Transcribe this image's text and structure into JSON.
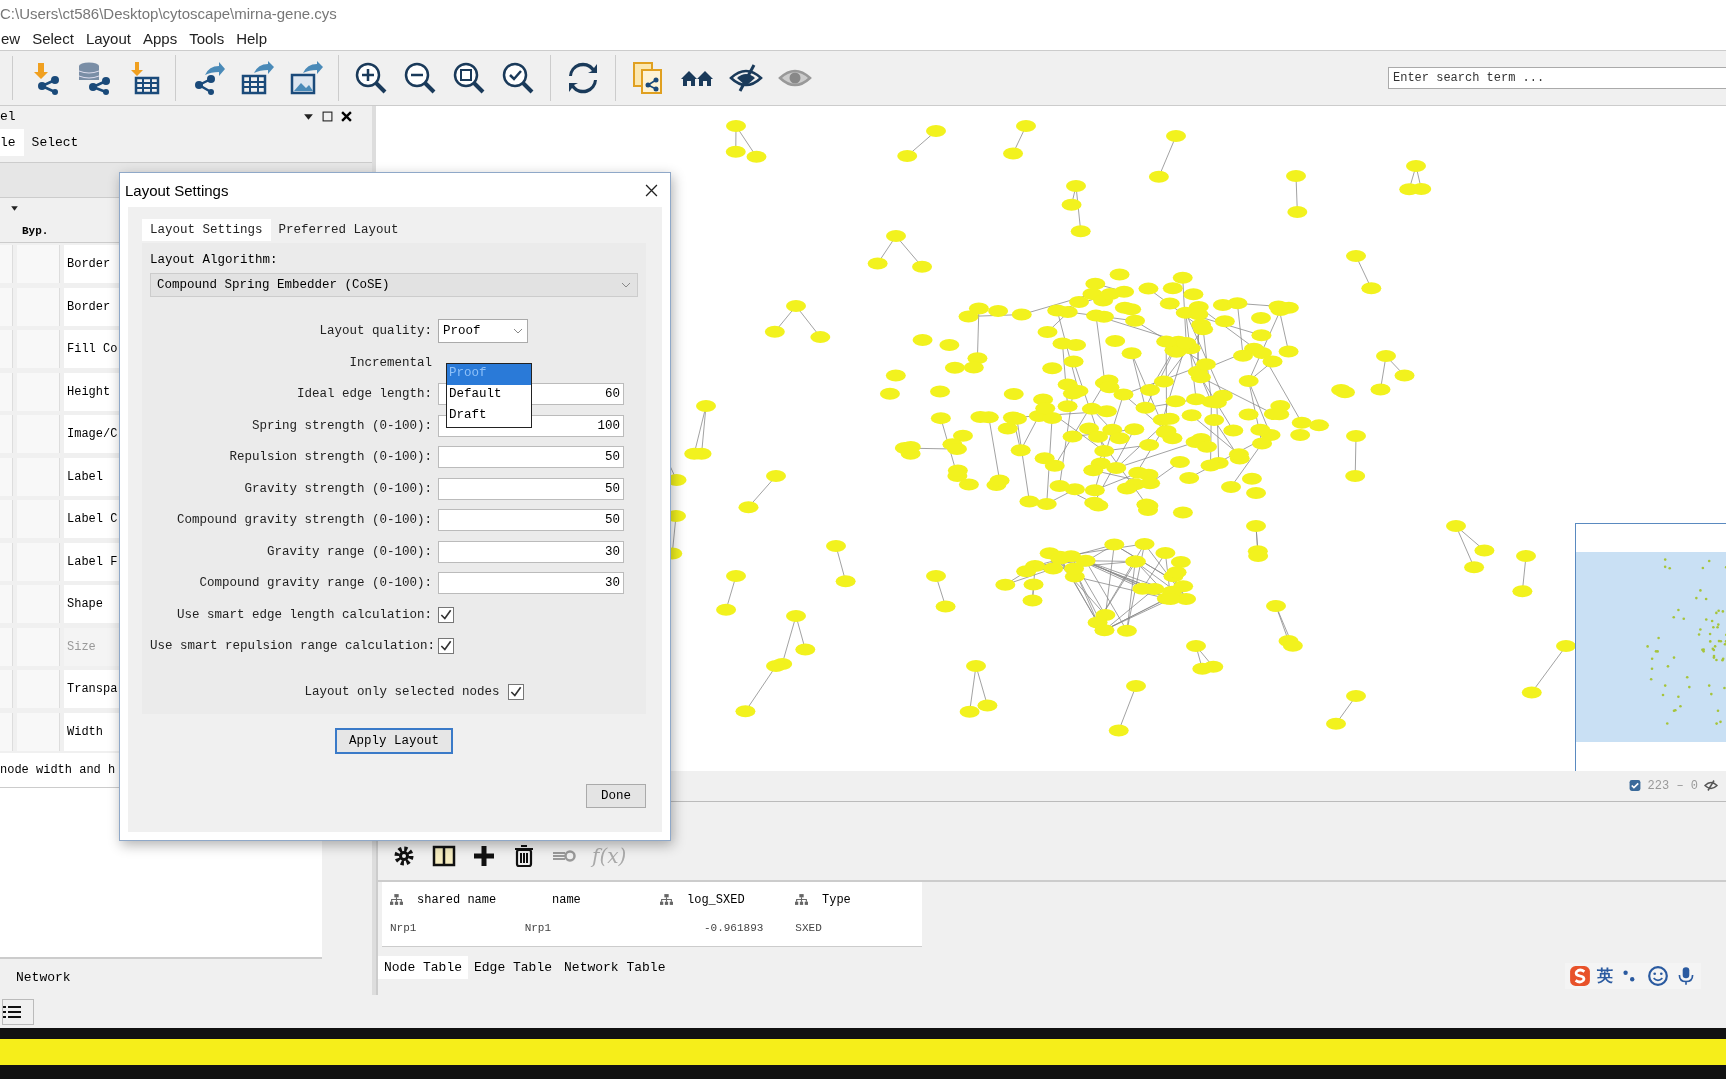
{
  "window": {
    "title": "C:\\Users\\ct586\\Desktop\\cytoscape\\mirna-gene.cys"
  },
  "menu": [
    {
      "label": "ew"
    },
    {
      "label": "Select"
    },
    {
      "label": "Layout"
    },
    {
      "label": "Apps"
    },
    {
      "label": "Tools"
    },
    {
      "label": "Help"
    }
  ],
  "search": {
    "placeholder": "Enter search term ..."
  },
  "control_panel": {
    "title": "el",
    "tabs": [
      {
        "label": "le",
        "selected": true
      },
      {
        "label": "Select",
        "selected": false
      }
    ],
    "column_header": "Byp.",
    "properties": [
      {
        "label": "Border",
        "disabled": false
      },
      {
        "label": "Border",
        "disabled": false
      },
      {
        "label": "Fill Co",
        "disabled": false
      },
      {
        "label": "Height",
        "disabled": false
      },
      {
        "label": "Image/C",
        "disabled": false
      },
      {
        "label": "Label",
        "disabled": false
      },
      {
        "label": "Label C",
        "disabled": false
      },
      {
        "label": "Label F",
        "disabled": false
      },
      {
        "label": "Shape",
        "disabled": false
      },
      {
        "label": "Size",
        "disabled": true
      },
      {
        "label": "Transpa",
        "disabled": false
      },
      {
        "label": "Width",
        "disabled": false
      }
    ],
    "note": "node width and h",
    "bottom_tab": "Network"
  },
  "network_view": {
    "status": "223 – 0"
  },
  "table_panel": {
    "formula_button": "f(x)",
    "columns": [
      {
        "label": "shared name",
        "shared": true
      },
      {
        "label": "name",
        "shared": false
      },
      {
        "label": "log_SXED",
        "shared": true
      },
      {
        "label": "Type",
        "shared": true
      }
    ],
    "rows": [
      [
        "Nrp1",
        "Nrp1",
        "-0.961893",
        "SXED"
      ]
    ],
    "tabs": [
      {
        "label": "Node Table",
        "selected": true
      },
      {
        "label": "Edge Table",
        "selected": false
      },
      {
        "label": "Network Table",
        "selected": false
      }
    ]
  },
  "dialog": {
    "title": "Layout Settings",
    "tabs": [
      {
        "label": "Layout Settings",
        "selected": true
      },
      {
        "label": "Preferred Layout",
        "selected": false
      }
    ],
    "algorithm_label": "Layout Algorithm:",
    "algorithm": "Compound Spring Embedder (CoSE)",
    "quality_label": "Layout quality:",
    "quality": "Proof",
    "quality_options": [
      {
        "label": "Proof",
        "selected": true
      },
      {
        "label": "Default",
        "selected": false
      },
      {
        "label": "Draft",
        "selected": false
      }
    ],
    "settings": [
      {
        "kind": "checkbox",
        "label": "Incremental"
      },
      {
        "kind": "number",
        "label": "Ideal edge length:",
        "value": "60"
      },
      {
        "kind": "number",
        "label": "Spring strength (0-100):",
        "value": "100"
      },
      {
        "kind": "number",
        "label": "Repulsion strength (0-100):",
        "value": "50"
      },
      {
        "kind": "number",
        "label": "Gravity strength (0-100):",
        "value": "50"
      },
      {
        "kind": "number",
        "label": "Compound gravity strength (0-100):",
        "value": "50"
      },
      {
        "kind": "number",
        "label": "Gravity range (0-100):",
        "value": "30"
      },
      {
        "kind": "number",
        "label": "Compound gravity range (0-100):",
        "value": "30"
      },
      {
        "kind": "checkbox",
        "label": "Use smart edge length calculation:",
        "checked": true
      },
      {
        "kind": "checkbox",
        "label": "Use smart repulsion range calculation:",
        "checked": true
      }
    ],
    "selected_only": {
      "label": "Layout only selected nodes",
      "checked": true
    },
    "apply_button": "Apply Layout",
    "done_button": "Done"
  },
  "ime": {
    "label": "英"
  }
}
